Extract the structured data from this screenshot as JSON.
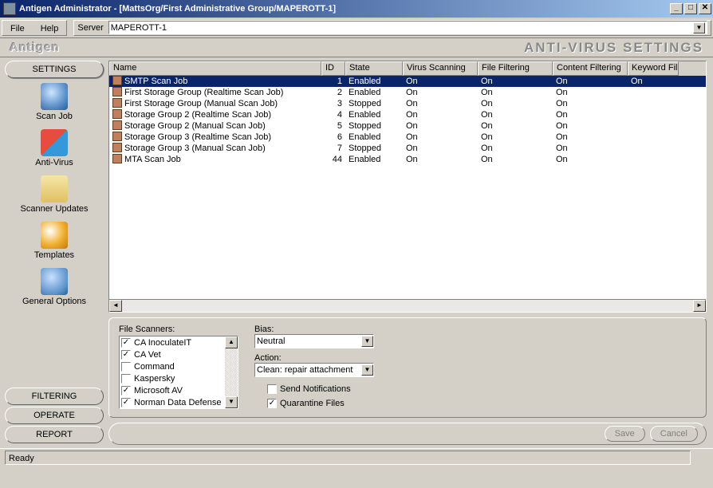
{
  "window": {
    "title": "Antigen Administrator - [MattsOrg/First Administrative Group/MAPEROTT-1]"
  },
  "menu": {
    "file": "File",
    "help": "Help",
    "server_label": "Server",
    "server_value": "MAPEROTT-1"
  },
  "brand": {
    "name": "Antigen",
    "page": "ANTI-VIRUS SETTINGS"
  },
  "sidebar": {
    "settings_label": "SETTINGS",
    "items": [
      {
        "label": "Scan Job"
      },
      {
        "label": "Anti-Virus"
      },
      {
        "label": "Scanner Updates"
      },
      {
        "label": "Templates"
      },
      {
        "label": "General Options"
      }
    ],
    "filtering_label": "FILTERING",
    "operate_label": "OPERATE",
    "report_label": "REPORT"
  },
  "table": {
    "columns": {
      "name": "Name",
      "id": "ID",
      "state": "State",
      "vs": "Virus Scanning",
      "ff": "File Filtering",
      "cf": "Content Filtering",
      "kf": "Keyword Fil"
    },
    "rows": [
      {
        "name": "SMTP Scan Job",
        "id": "1",
        "state": "Enabled",
        "vs": "On",
        "ff": "On",
        "cf": "On",
        "kf": "On",
        "selected": true
      },
      {
        "name": "First Storage Group (Realtime Scan Job)",
        "id": "2",
        "state": "Enabled",
        "vs": "On",
        "ff": "On",
        "cf": "On",
        "kf": "",
        "selected": false
      },
      {
        "name": "First Storage Group (Manual Scan Job)",
        "id": "3",
        "state": "Stopped",
        "vs": "On",
        "ff": "On",
        "cf": "On",
        "kf": "",
        "selected": false
      },
      {
        "name": "Storage Group 2 (Realtime Scan Job)",
        "id": "4",
        "state": "Enabled",
        "vs": "On",
        "ff": "On",
        "cf": "On",
        "kf": "",
        "selected": false
      },
      {
        "name": "Storage Group 2 (Manual Scan Job)",
        "id": "5",
        "state": "Stopped",
        "vs": "On",
        "ff": "On",
        "cf": "On",
        "kf": "",
        "selected": false
      },
      {
        "name": "Storage Group 3 (Realtime Scan Job)",
        "id": "6",
        "state": "Enabled",
        "vs": "On",
        "ff": "On",
        "cf": "On",
        "kf": "",
        "selected": false
      },
      {
        "name": "Storage Group 3 (Manual Scan Job)",
        "id": "7",
        "state": "Stopped",
        "vs": "On",
        "ff": "On",
        "cf": "On",
        "kf": "",
        "selected": false
      },
      {
        "name": "MTA Scan Job",
        "id": "44",
        "state": "Enabled",
        "vs": "On",
        "ff": "On",
        "cf": "On",
        "kf": "",
        "selected": false
      }
    ]
  },
  "settings": {
    "file_scanners_label": "File Scanners:",
    "scanners": [
      {
        "label": "CA InoculateIT",
        "checked": true
      },
      {
        "label": "CA Vet",
        "checked": true
      },
      {
        "label": "Command",
        "checked": false
      },
      {
        "label": "Kaspersky",
        "checked": false
      },
      {
        "label": "Microsoft AV",
        "checked": true
      },
      {
        "label": "Norman Data Defense",
        "checked": true
      }
    ],
    "bias_label": "Bias:",
    "bias_value": "Neutral",
    "action_label": "Action:",
    "action_value": "Clean: repair attachment",
    "send_notifications_label": "Send Notifications",
    "send_notifications_checked": false,
    "quarantine_label": "Quarantine Files",
    "quarantine_checked": true
  },
  "buttons": {
    "save": "Save",
    "cancel": "Cancel"
  },
  "status": {
    "text": "Ready"
  },
  "icons": {
    "scan_job": {
      "bg": "radial-gradient(circle at 40% 35%, #cde6ff 0%, #5d8fc8 60%, #2b5e95 100%)"
    },
    "anti_virus": {
      "bg": "linear-gradient(135deg, #e74c3c 0 50%, #3498db 50% 100%)"
    },
    "scanner_updates": {
      "bg": "linear-gradient(#f5e6a8, #e0c060)"
    },
    "templates": {
      "bg": "radial-gradient(circle at 35% 35%, #fff 0%, #f0b030 55%, #c07810 100%)"
    },
    "general_options": {
      "bg": "radial-gradient(circle at 40% 35%, #c8e0ff 0%, #5a90c8 70%, #2b5e95 100%)"
    }
  }
}
